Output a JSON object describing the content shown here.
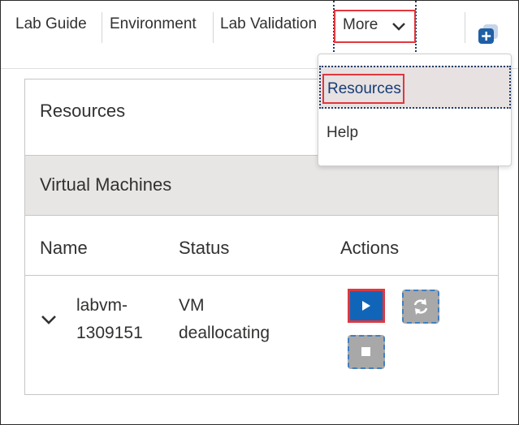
{
  "tabs": [
    {
      "label": "Lab Guide"
    },
    {
      "label": "Environment"
    },
    {
      "label": "Lab Validation"
    }
  ],
  "more": {
    "label": "More"
  },
  "menu": {
    "items": [
      {
        "label": "Resources",
        "selected": true
      },
      {
        "label": "Help",
        "selected": false
      }
    ]
  },
  "panel": {
    "title": "Resources",
    "section_title": "Virtual Machines",
    "columns": [
      "Name",
      "Status",
      "Actions"
    ],
    "rows": [
      {
        "name_line1": "labvm-",
        "name_line2": "1309151",
        "status_line1": "VM",
        "status_line2": "deallocating"
      }
    ]
  },
  "colors": {
    "accent_blue": "#1165b8",
    "highlight_red": "#e0373d",
    "disabled_gray": "#a8a8a8",
    "section_bg": "#e8e6e5"
  },
  "icons": {
    "more_chevron": "chevron-down-icon",
    "add": "add-square-icon",
    "start": "play-icon",
    "restart": "refresh-icon",
    "stop": "stop-icon",
    "expand": "chevron-down-icon"
  }
}
